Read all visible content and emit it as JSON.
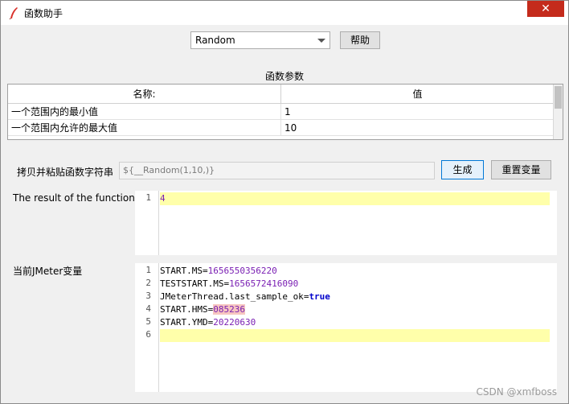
{
  "window": {
    "title": "函数助手",
    "close_glyph": "✕"
  },
  "function_select": {
    "value": "Random"
  },
  "help_button": "帮助",
  "params": {
    "section_title": "函数参数",
    "headers": {
      "name": "名称:",
      "value": "值"
    },
    "rows": [
      {
        "name": "一个范围内的最小值",
        "value": "1"
      },
      {
        "name": "一个范围内允许的最大值",
        "value": "10"
      }
    ]
  },
  "copy_row": {
    "label": "拷贝并粘贴函数字符串",
    "value": "${__Random(1,10,)}",
    "generate_button": "生成",
    "reset_button": "重置变量"
  },
  "result": {
    "label": "The result of the function is",
    "lines": [
      {
        "num": "1",
        "text": "4"
      }
    ]
  },
  "jmeter_vars": {
    "label": "当前JMeter变量",
    "lines": [
      {
        "num": "1",
        "key": "START.MS",
        "eq": "=",
        "val": "1656550356220"
      },
      {
        "num": "2",
        "key": "TESTSTART.MS",
        "eq": "=",
        "val": "1656572416090"
      },
      {
        "num": "3",
        "key": "JMeterThread.last_sample_ok",
        "eq": "=",
        "val": "true"
      },
      {
        "num": "4",
        "key": "START.HMS",
        "eq": "=",
        "val": "085236"
      },
      {
        "num": "5",
        "key": "START.YMD",
        "eq": "=",
        "val": "20220630"
      },
      {
        "num": "6",
        "key": "",
        "eq": "",
        "val": ""
      }
    ]
  },
  "watermark": "CSDN @xmfboss",
  "colors": {
    "highlight": "#ffffaa",
    "value": "#7a1fb3",
    "keyword": "#0000cc",
    "close": "#c42b1c"
  }
}
